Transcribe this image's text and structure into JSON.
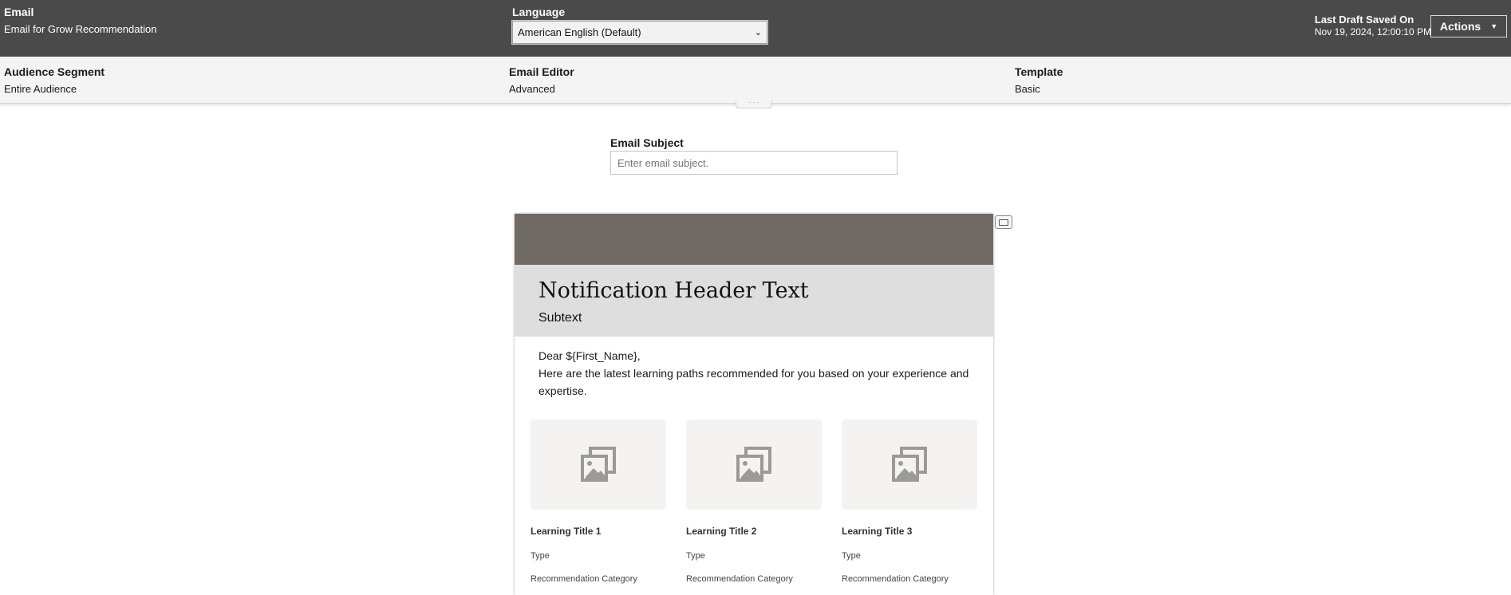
{
  "header": {
    "email_label": "Email",
    "email_value": "Email for Grow Recommendation",
    "language_label": "Language",
    "language_selected": "American English (Default)",
    "saved_label": "Last Draft Saved On",
    "saved_value": "Nov 19, 2024, 12:00:10 PM",
    "actions_label": "Actions"
  },
  "info": {
    "audience_label": "Audience Segment",
    "audience_value": "Entire Audience",
    "editor_label": "Email Editor",
    "editor_value": "Advanced",
    "template_label": "Template",
    "template_value": "Basic",
    "collapse_glyph": "· · ·"
  },
  "subject": {
    "label": "Email Subject",
    "placeholder": "Enter email subject."
  },
  "preview": {
    "header_title": "Notification Header Text",
    "subtext": "Subtext",
    "greeting": "Dear ${First_Name},",
    "body": "Here are the latest learning paths recommended for you based on your experience and expertise.",
    "cards": [
      {
        "title": "Learning Title 1",
        "type": "Type",
        "category": "Recommendation Category"
      },
      {
        "title": "Learning Title 2",
        "type": "Type",
        "category": "Recommendation Category"
      },
      {
        "title": "Learning Title 3",
        "type": "Type",
        "category": "Recommendation Category"
      }
    ]
  },
  "icons": {
    "thumb": "image-placeholder-icon",
    "device": "desktop-preview-icon",
    "dropdown": "chevron-down-icon",
    "actions": "triangle-down-icon"
  },
  "colors": {
    "topbar": "#4a4a4a",
    "banner": "#706a64",
    "notif_bg": "#dedede"
  }
}
